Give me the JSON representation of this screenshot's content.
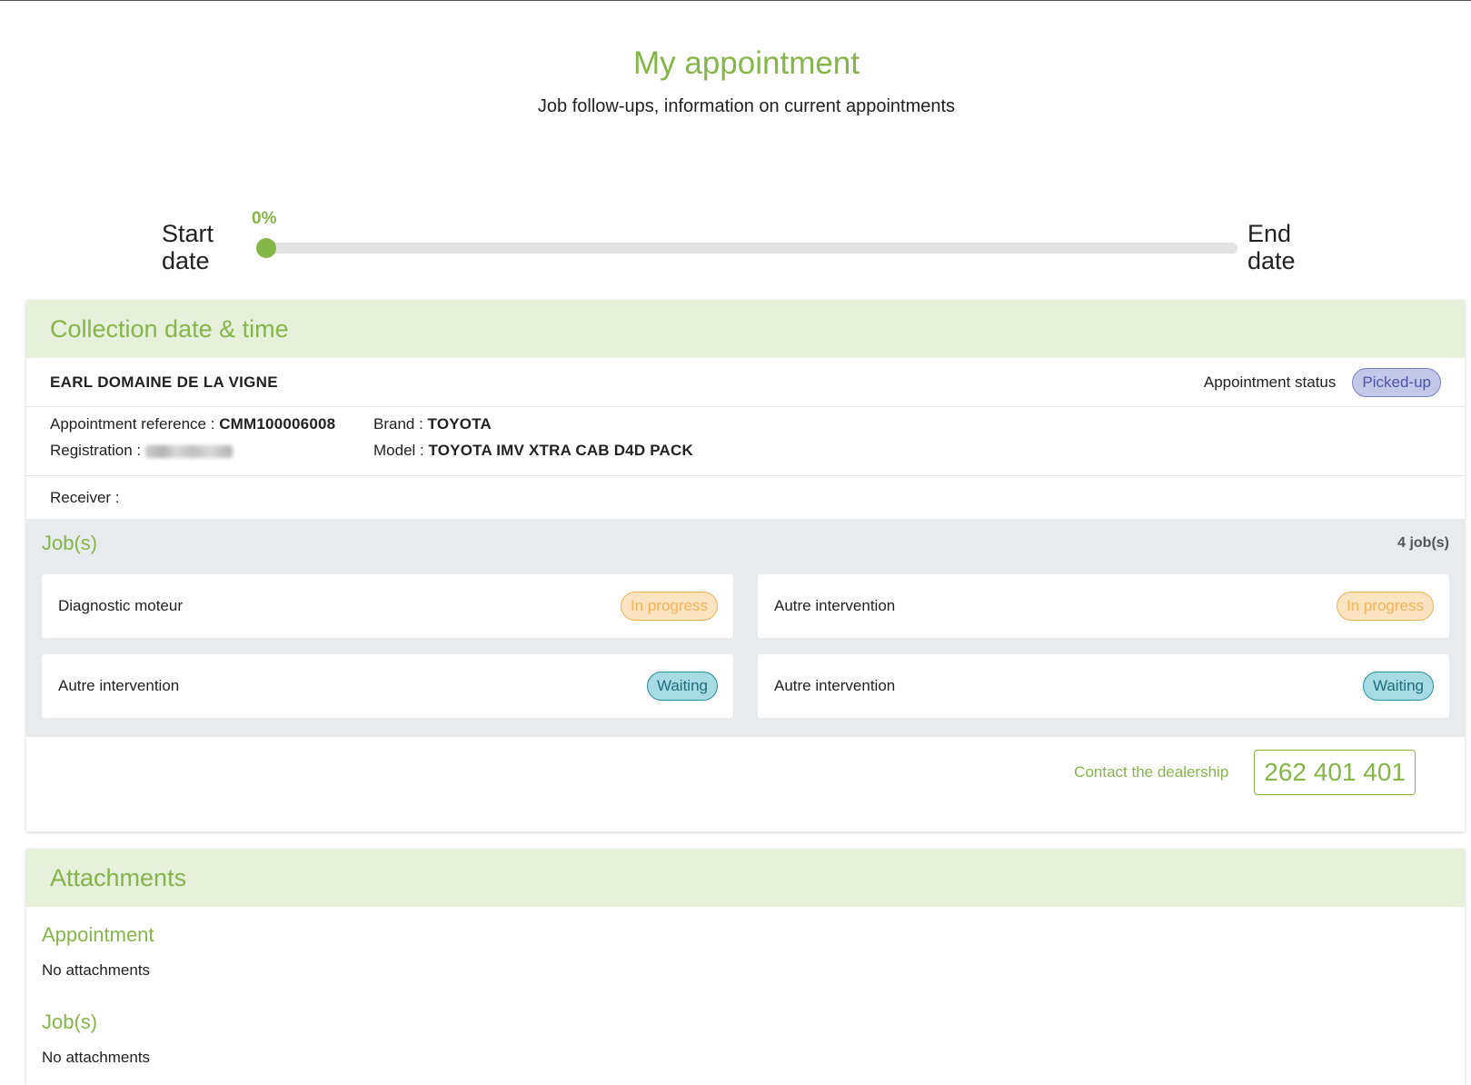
{
  "header": {
    "title": "My appointment",
    "subtitle": "Job follow-ups, information on current appointments"
  },
  "progress": {
    "start_label": "Start date",
    "end_label": "End date",
    "percent_label": "0%",
    "percent": 0
  },
  "collection": {
    "title": "Collection date & time",
    "customer": "EARL DOMAINE DE LA VIGNE",
    "status_label": "Appointment status",
    "status": "Picked-up",
    "reference_label": "Appointment reference :",
    "reference": "CMM100006008",
    "registration_label": "Registration :",
    "brand_label": "Brand :",
    "brand": "TOYOTA",
    "model_label": "Model :",
    "model": "TOYOTA IMV XTRA CAB D4D PACK",
    "receiver_label": "Receiver :"
  },
  "jobs": {
    "title": "Job(s)",
    "count": "4 job(s)",
    "items": [
      {
        "name": "Diagnostic moteur",
        "status": "In progress"
      },
      {
        "name": "Autre intervention",
        "status": "In progress"
      },
      {
        "name": "Autre intervention",
        "status": "Waiting"
      },
      {
        "name": "Autre intervention",
        "status": "Waiting"
      }
    ]
  },
  "contact": {
    "label": "Contact the dealership",
    "phone": "262 401 401"
  },
  "attachments": {
    "title": "Attachments",
    "appointment_title": "Appointment",
    "appointment_empty": "No attachments",
    "jobs_title": "Job(s)",
    "jobs_empty": "No attachments"
  },
  "colors": {
    "accent": "#86b54a",
    "header_bg": "#e6f0da",
    "picked_badge": "#c3c8ea",
    "progress_badge": "#fce3bf",
    "waiting_badge": "#a6dbe1"
  }
}
